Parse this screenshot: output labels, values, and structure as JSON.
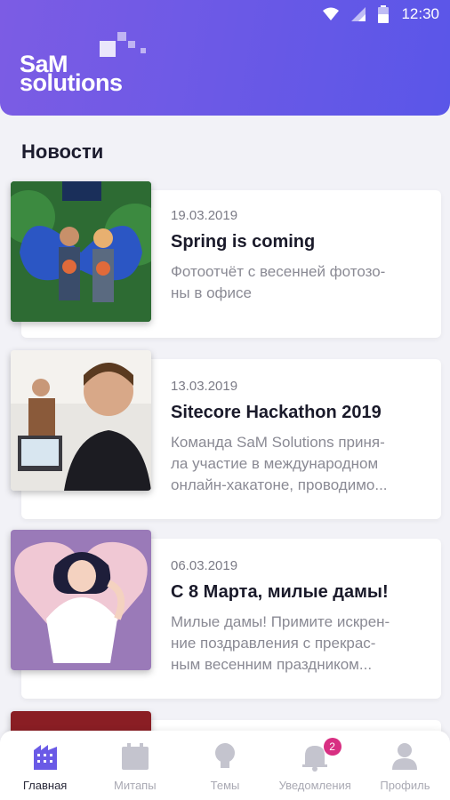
{
  "status_bar": {
    "time": "12:30",
    "icons": [
      "wifi-icon",
      "signal-icon",
      "battery-icon"
    ]
  },
  "header": {
    "logo_line1": "SaM",
    "logo_line2": "solutions",
    "gradient": [
      "#7c5ce4",
      "#5a56e8"
    ]
  },
  "section_title": "Новости",
  "news": [
    {
      "date": "19.03.2019",
      "title": "Spring is coming",
      "description": "Фотоотчёт с весенней фотозо-\nны в офисе"
    },
    {
      "date": "13.03.2019",
      "title": "Sitecore Hackathon 2019",
      "description": "Команда SaM Solutions приня-\nла участие в международном\nонлайн-хакатоне, проводимо..."
    },
    {
      "date": "06.03.2019",
      "title": "С 8 Марта, милые дамы!",
      "description": "Милые дамы! Примите искрен-\nние поздравления с прекрас-\nным весенним праздником..."
    }
  ],
  "bottom_nav": {
    "items": [
      {
        "label": "Главная",
        "icon": "building-icon",
        "active": true
      },
      {
        "label": "Митапы",
        "icon": "calendar-icon",
        "active": false
      },
      {
        "label": "Темы",
        "icon": "lightbulb-icon",
        "active": false
      },
      {
        "label": "Уведомления",
        "icon": "bell-icon",
        "active": false,
        "badge": "2"
      },
      {
        "label": "Профиль",
        "icon": "person-icon",
        "active": false
      }
    ]
  },
  "colors": {
    "accent": "#6a5ae6",
    "badge": "#d82f82"
  }
}
